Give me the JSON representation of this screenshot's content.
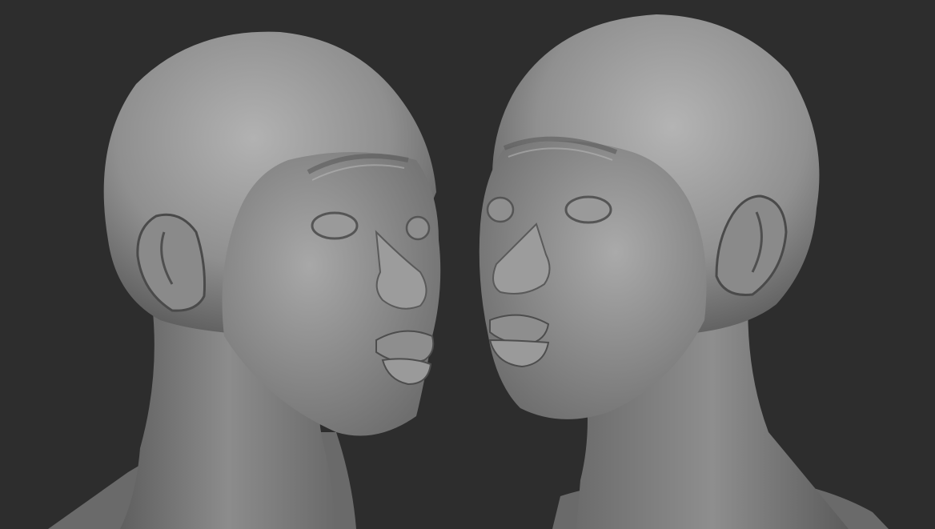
{
  "scene": {
    "background_color": "#2d2d2d",
    "clay_color": "#8a8a8a",
    "subjects": [
      {
        "icon": "sculpted-head-icon",
        "facing": "right",
        "expression": "pursed-lips"
      },
      {
        "icon": "sculpted-head-icon",
        "facing": "left",
        "expression": "pursed-lips"
      }
    ]
  }
}
